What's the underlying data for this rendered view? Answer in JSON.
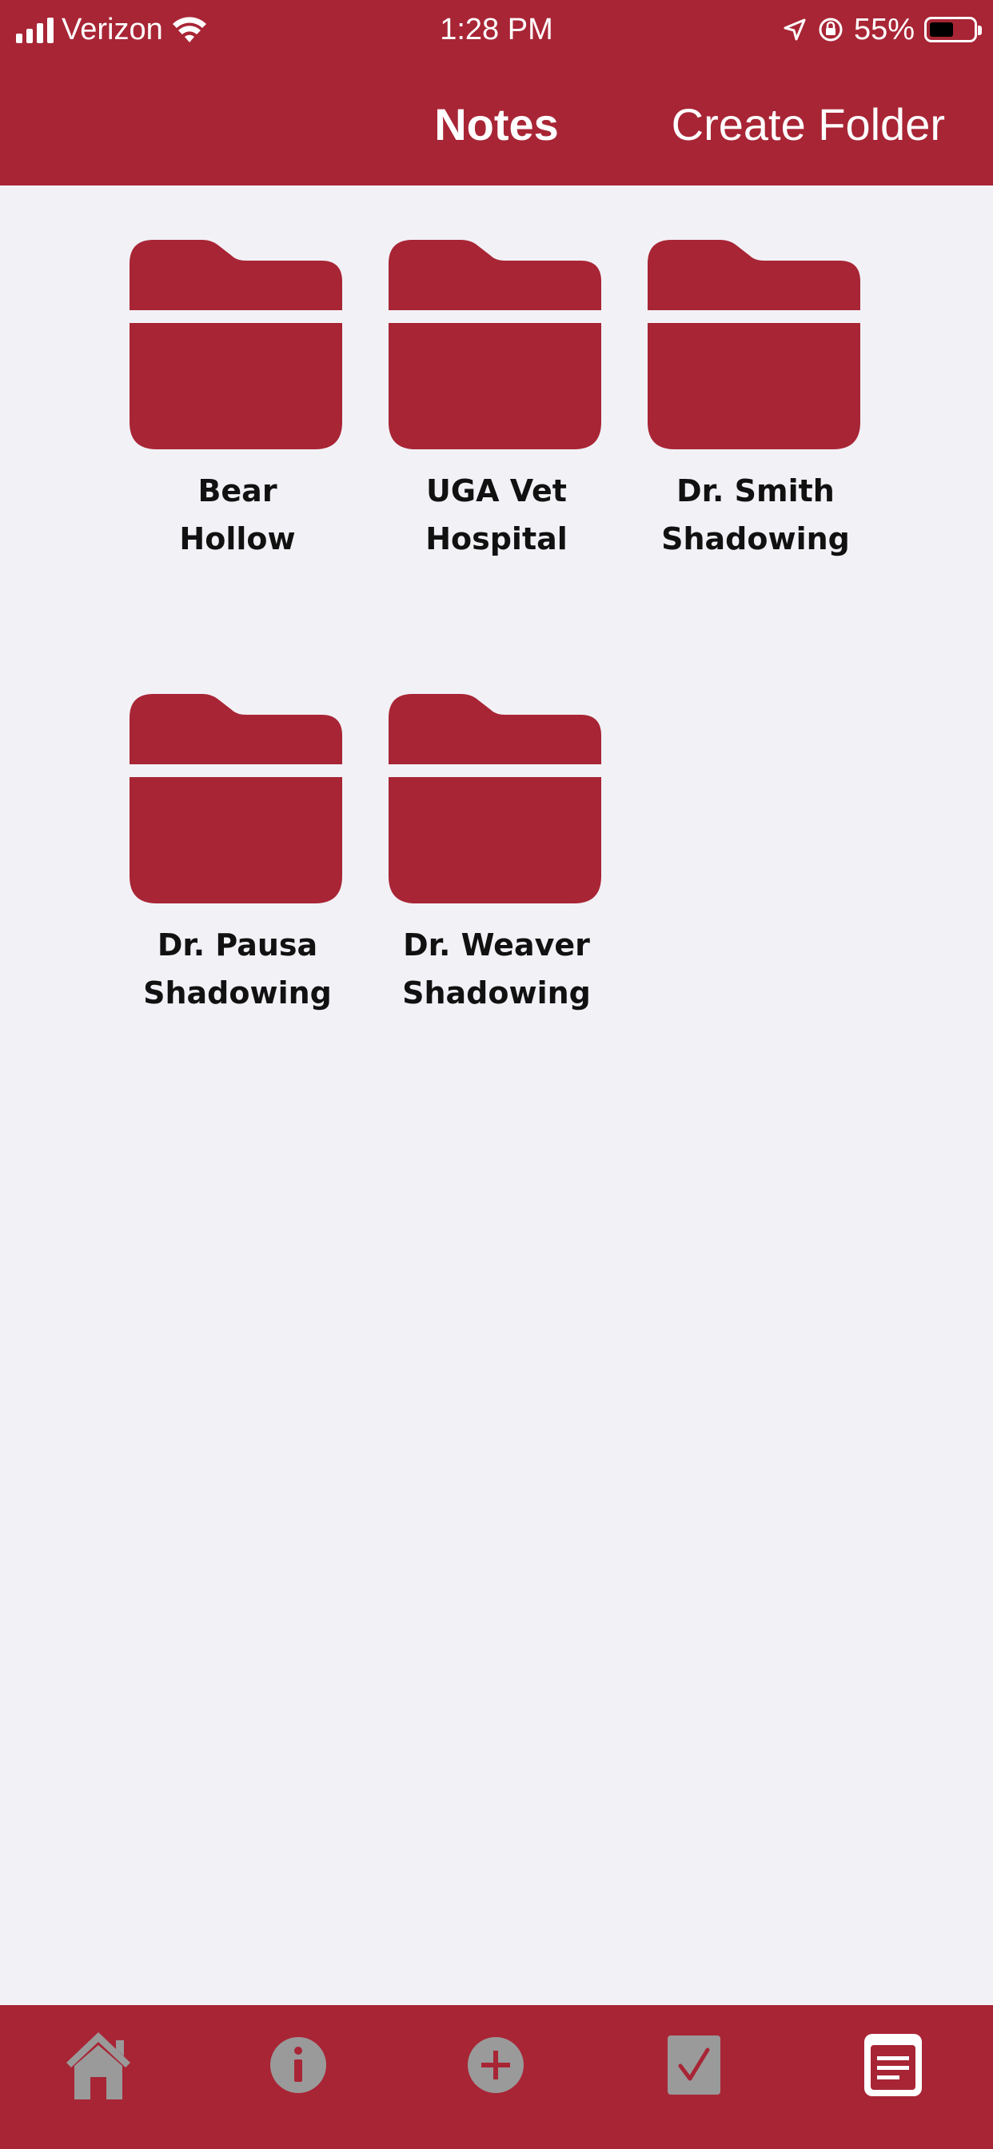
{
  "status_bar": {
    "carrier": "Verizon",
    "time": "1:28 PM",
    "battery_percent": "55%",
    "battery_level": 0.55,
    "icons": [
      "signal-icon",
      "wifi-icon",
      "location-icon",
      "rotation-lock-icon",
      "battery-icon"
    ]
  },
  "header": {
    "title": "Notes",
    "create_folder_label": "Create Folder"
  },
  "folders": [
    {
      "label": "Bear\nHollow"
    },
    {
      "label": "UGA Vet\nHospital"
    },
    {
      "label": "Dr. Smith\nShadowing"
    },
    {
      "label": "Dr. Pausa\nShadowing"
    },
    {
      "label": "Dr. Weaver\nShadowing"
    }
  ],
  "tab_bar": {
    "tabs": [
      {
        "icon": "home-icon",
        "active": false
      },
      {
        "icon": "info-icon",
        "active": false
      },
      {
        "icon": "add-icon",
        "active": false
      },
      {
        "icon": "checkbox-icon",
        "active": false
      },
      {
        "icon": "notes-icon",
        "active": true
      }
    ]
  },
  "colors": {
    "accent": "#a82535",
    "background": "#f2f1f6",
    "inactive_icon": "#9a9a9a",
    "active_icon": "#ffffff"
  }
}
